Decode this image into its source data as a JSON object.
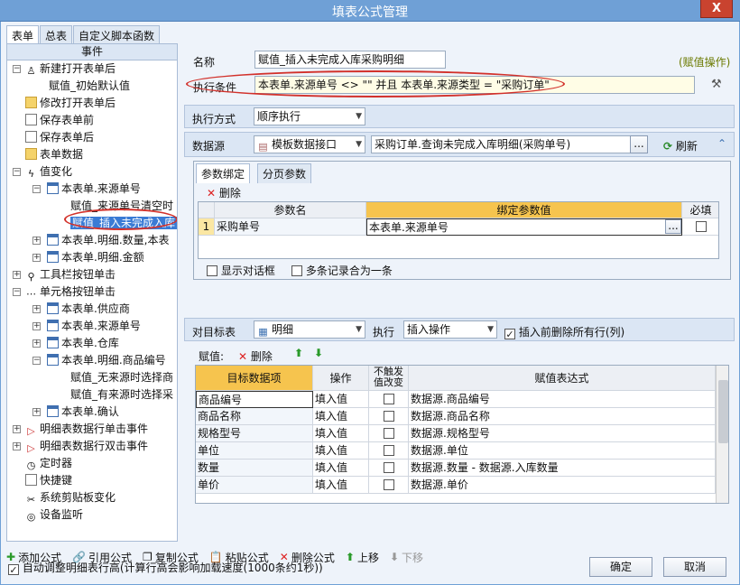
{
  "window": {
    "title": "填表公式管理",
    "close_label": "X"
  },
  "tabs": [
    "表单",
    "总表",
    "自定义脚本函数"
  ],
  "tree": {
    "header": "事件",
    "items": [
      "新建打开表单后",
      "赋值_初始默认值",
      "修改打开表单后",
      "保存表单前",
      "保存表单后",
      "表单数据",
      "值变化",
      "本表单.来源单号",
      "赋值_来源单号清空时",
      "赋值_插入未完成入库",
      "本表单.明细.数量,本表",
      "本表单.明细.金额",
      "工具栏按钮单击",
      "单元格按钮单击",
      "本表单.供应商",
      "本表单.来源单号",
      "本表单.仓库",
      "本表单.明细.商品编号",
      "赋值_无来源时选择商",
      "赋值_有来源时选择采",
      "本表单.确认",
      "明细表数据行单击事件",
      "明细表数据行双击事件",
      "定时器",
      "快捷键",
      "系统剪贴板变化",
      "设备监听"
    ]
  },
  "form": {
    "name_label": "名称",
    "name_value": "赋值_插入未完成入库采购明细",
    "op_tag": "(赋值操作)",
    "cond_label": "执行条件",
    "cond_value": "本表单.来源单号  <>  \"\" 并且 本表单.来源类型  =  \"采购订单\"",
    "mode_label": "执行方式",
    "mode_value": "顺序执行",
    "ds_label": "数据源",
    "ds_type": "模板数据接口",
    "ds_value": "采购订单.查询未完成入库明细(采购单号)",
    "ellipsis": "...",
    "refresh_label": "刷新"
  },
  "params": {
    "tabs": [
      "参数绑定",
      "分页参数"
    ],
    "delete_label": "删除",
    "headers": [
      "参数名",
      "绑定参数值",
      "必填"
    ],
    "rows": [
      {
        "no": "1",
        "name": "采购单号",
        "value": "本表单.来源单号"
      }
    ],
    "show_dialog": "显示对话框",
    "merge": "多条记录合为一条"
  },
  "target": {
    "label": "对目标表",
    "table": "明细",
    "exec_label": "执行",
    "exec_value": "插入操作",
    "clear_label": "插入前删除所有行(列)",
    "assign_label": "赋值:",
    "delete_label": "删除",
    "headers": [
      "目标数据项",
      "操作",
      "不触发\n值改变",
      "赋值表达式"
    ],
    "rows": [
      {
        "item": "商品编号",
        "op": "填入值",
        "expr": "数据源.商品编号"
      },
      {
        "item": "商品名称",
        "op": "填入值",
        "expr": "数据源.商品名称"
      },
      {
        "item": "规格型号",
        "op": "填入值",
        "expr": "数据源.规格型号"
      },
      {
        "item": "单位",
        "op": "填入值",
        "expr": "数据源.单位"
      },
      {
        "item": "数量",
        "op": "填入值",
        "expr": "数据源.数量 - 数据源.入库数量"
      },
      {
        "item": "单价",
        "op": "填入值",
        "expr": "数据源.单价"
      }
    ]
  },
  "toolbar": {
    "add": "添加公式",
    "ref": "引用公式",
    "copy": "复制公式",
    "paste": "粘贴公式",
    "del": "删除公式",
    "up": "上移",
    "down": "下移"
  },
  "footer": {
    "auto_adjust": "自动调整明细表行高(计算行高会影响加载速度(1000条约1秒))",
    "ok": "确定",
    "cancel": "取消"
  }
}
